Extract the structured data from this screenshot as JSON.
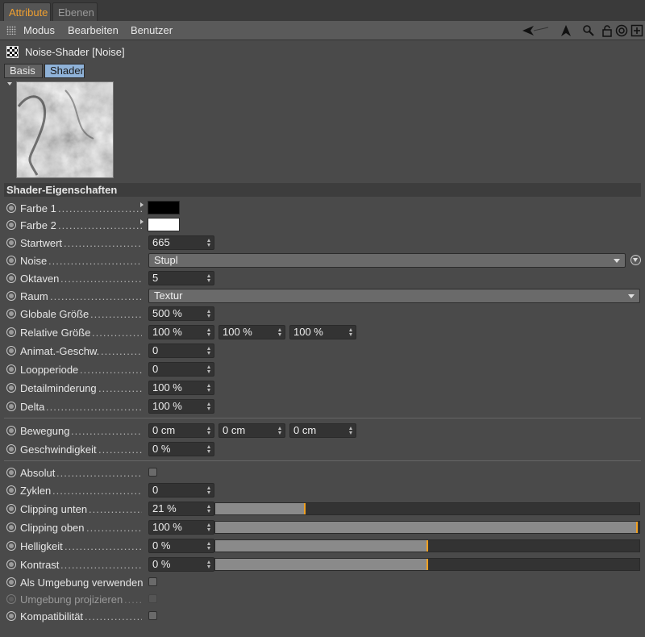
{
  "tabs": [
    {
      "label": "Attribute",
      "active": true
    },
    {
      "label": "Ebenen",
      "active": false
    }
  ],
  "menu": {
    "items": [
      "Modus",
      "Bearbeiten",
      "Benutzer"
    ],
    "toolbar_icons": [
      "back-arrow-icon",
      "pointer-arrow-icon",
      "search-icon",
      "lock-icon",
      "target-icon",
      "new-panel-icon"
    ]
  },
  "object": {
    "title": "Noise-Shader [Noise]",
    "icon": "checkerboard-icon"
  },
  "subtabs": [
    {
      "label": "Basis",
      "active": false
    },
    {
      "label": "Shader",
      "active": true
    }
  ],
  "section": {
    "title": "Shader-Eigenschaften"
  },
  "params": {
    "farbe1": {
      "label": "Farbe 1",
      "color": "#000000"
    },
    "farbe2": {
      "label": "Farbe 2",
      "color": "#ffffff"
    },
    "startwert": {
      "label": "Startwert",
      "value": "665"
    },
    "noise": {
      "label": "Noise",
      "value": "Stupl"
    },
    "oktaven": {
      "label": "Oktaven",
      "value": "5"
    },
    "raum": {
      "label": "Raum",
      "value": "Textur"
    },
    "globale_groesse": {
      "label": "Globale Größe",
      "value": "500 %"
    },
    "relative_groesse": {
      "label": "Relative Größe",
      "values": [
        "100 %",
        "100 %",
        "100 %"
      ]
    },
    "animat_geschw": {
      "label": "Animat.-Geschw.",
      "value": "0"
    },
    "loopperiode": {
      "label": "Loopperiode",
      "value": "0"
    },
    "detailminderung": {
      "label": "Detailminderung",
      "value": "100 %"
    },
    "delta": {
      "label": "Delta",
      "value": "100 %"
    },
    "bewegung": {
      "label": "Bewegung",
      "values": [
        "0 cm",
        "0 cm",
        "0 cm"
      ]
    },
    "geschwindigkeit": {
      "label": "Geschwindigkeit",
      "value": "0 %"
    },
    "absolut": {
      "label": "Absolut",
      "checked": false
    },
    "zyklen": {
      "label": "Zyklen",
      "value": "0"
    },
    "clipping_unten": {
      "label": "Clipping unten",
      "value": "21 %",
      "level": 0.21
    },
    "clipping_oben": {
      "label": "Clipping oben",
      "value": "100 %",
      "level": 1.0
    },
    "helligkeit": {
      "label": "Helligkeit",
      "value": "0 %",
      "level": 0.5
    },
    "kontrast": {
      "label": "Kontrast",
      "value": "0 %",
      "level": 0.5
    },
    "als_umgebung": {
      "label": "Als Umgebung verwenden",
      "checked": false
    },
    "umgebung_projizieren": {
      "label": "Umgebung projizieren",
      "checked": false,
      "enabled": false
    },
    "kompatibilitaet": {
      "label": "Kompatibilität",
      "checked": false
    }
  },
  "colors": {
    "accent": "#f0a030",
    "active_subtab": "#8fb2d8",
    "slider_marker": "#f0a020"
  }
}
